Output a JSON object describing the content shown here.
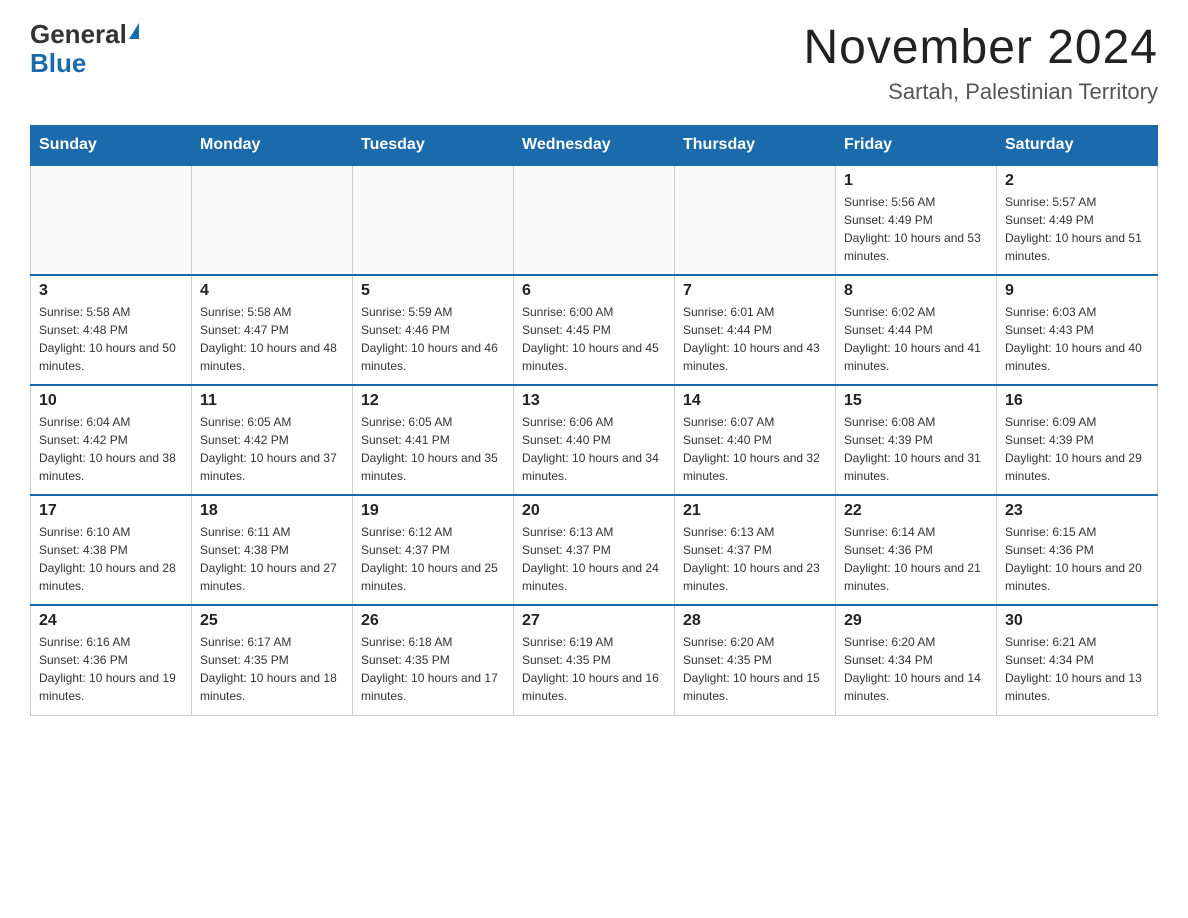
{
  "logo": {
    "general": "General",
    "blue": "Blue"
  },
  "title": "November 2024",
  "subtitle": "Sartah, Palestinian Territory",
  "days_of_week": [
    "Sunday",
    "Monday",
    "Tuesday",
    "Wednesday",
    "Thursday",
    "Friday",
    "Saturday"
  ],
  "weeks": [
    [
      {
        "day": "",
        "info": ""
      },
      {
        "day": "",
        "info": ""
      },
      {
        "day": "",
        "info": ""
      },
      {
        "day": "",
        "info": ""
      },
      {
        "day": "",
        "info": ""
      },
      {
        "day": "1",
        "info": "Sunrise: 5:56 AM\nSunset: 4:49 PM\nDaylight: 10 hours and 53 minutes."
      },
      {
        "day": "2",
        "info": "Sunrise: 5:57 AM\nSunset: 4:49 PM\nDaylight: 10 hours and 51 minutes."
      }
    ],
    [
      {
        "day": "3",
        "info": "Sunrise: 5:58 AM\nSunset: 4:48 PM\nDaylight: 10 hours and 50 minutes."
      },
      {
        "day": "4",
        "info": "Sunrise: 5:58 AM\nSunset: 4:47 PM\nDaylight: 10 hours and 48 minutes."
      },
      {
        "day": "5",
        "info": "Sunrise: 5:59 AM\nSunset: 4:46 PM\nDaylight: 10 hours and 46 minutes."
      },
      {
        "day": "6",
        "info": "Sunrise: 6:00 AM\nSunset: 4:45 PM\nDaylight: 10 hours and 45 minutes."
      },
      {
        "day": "7",
        "info": "Sunrise: 6:01 AM\nSunset: 4:44 PM\nDaylight: 10 hours and 43 minutes."
      },
      {
        "day": "8",
        "info": "Sunrise: 6:02 AM\nSunset: 4:44 PM\nDaylight: 10 hours and 41 minutes."
      },
      {
        "day": "9",
        "info": "Sunrise: 6:03 AM\nSunset: 4:43 PM\nDaylight: 10 hours and 40 minutes."
      }
    ],
    [
      {
        "day": "10",
        "info": "Sunrise: 6:04 AM\nSunset: 4:42 PM\nDaylight: 10 hours and 38 minutes."
      },
      {
        "day": "11",
        "info": "Sunrise: 6:05 AM\nSunset: 4:42 PM\nDaylight: 10 hours and 37 minutes."
      },
      {
        "day": "12",
        "info": "Sunrise: 6:05 AM\nSunset: 4:41 PM\nDaylight: 10 hours and 35 minutes."
      },
      {
        "day": "13",
        "info": "Sunrise: 6:06 AM\nSunset: 4:40 PM\nDaylight: 10 hours and 34 minutes."
      },
      {
        "day": "14",
        "info": "Sunrise: 6:07 AM\nSunset: 4:40 PM\nDaylight: 10 hours and 32 minutes."
      },
      {
        "day": "15",
        "info": "Sunrise: 6:08 AM\nSunset: 4:39 PM\nDaylight: 10 hours and 31 minutes."
      },
      {
        "day": "16",
        "info": "Sunrise: 6:09 AM\nSunset: 4:39 PM\nDaylight: 10 hours and 29 minutes."
      }
    ],
    [
      {
        "day": "17",
        "info": "Sunrise: 6:10 AM\nSunset: 4:38 PM\nDaylight: 10 hours and 28 minutes."
      },
      {
        "day": "18",
        "info": "Sunrise: 6:11 AM\nSunset: 4:38 PM\nDaylight: 10 hours and 27 minutes."
      },
      {
        "day": "19",
        "info": "Sunrise: 6:12 AM\nSunset: 4:37 PM\nDaylight: 10 hours and 25 minutes."
      },
      {
        "day": "20",
        "info": "Sunrise: 6:13 AM\nSunset: 4:37 PM\nDaylight: 10 hours and 24 minutes."
      },
      {
        "day": "21",
        "info": "Sunrise: 6:13 AM\nSunset: 4:37 PM\nDaylight: 10 hours and 23 minutes."
      },
      {
        "day": "22",
        "info": "Sunrise: 6:14 AM\nSunset: 4:36 PM\nDaylight: 10 hours and 21 minutes."
      },
      {
        "day": "23",
        "info": "Sunrise: 6:15 AM\nSunset: 4:36 PM\nDaylight: 10 hours and 20 minutes."
      }
    ],
    [
      {
        "day": "24",
        "info": "Sunrise: 6:16 AM\nSunset: 4:36 PM\nDaylight: 10 hours and 19 minutes."
      },
      {
        "day": "25",
        "info": "Sunrise: 6:17 AM\nSunset: 4:35 PM\nDaylight: 10 hours and 18 minutes."
      },
      {
        "day": "26",
        "info": "Sunrise: 6:18 AM\nSunset: 4:35 PM\nDaylight: 10 hours and 17 minutes."
      },
      {
        "day": "27",
        "info": "Sunrise: 6:19 AM\nSunset: 4:35 PM\nDaylight: 10 hours and 16 minutes."
      },
      {
        "day": "28",
        "info": "Sunrise: 6:20 AM\nSunset: 4:35 PM\nDaylight: 10 hours and 15 minutes."
      },
      {
        "day": "29",
        "info": "Sunrise: 6:20 AM\nSunset: 4:34 PM\nDaylight: 10 hours and 14 minutes."
      },
      {
        "day": "30",
        "info": "Sunrise: 6:21 AM\nSunset: 4:34 PM\nDaylight: 10 hours and 13 minutes."
      }
    ]
  ]
}
